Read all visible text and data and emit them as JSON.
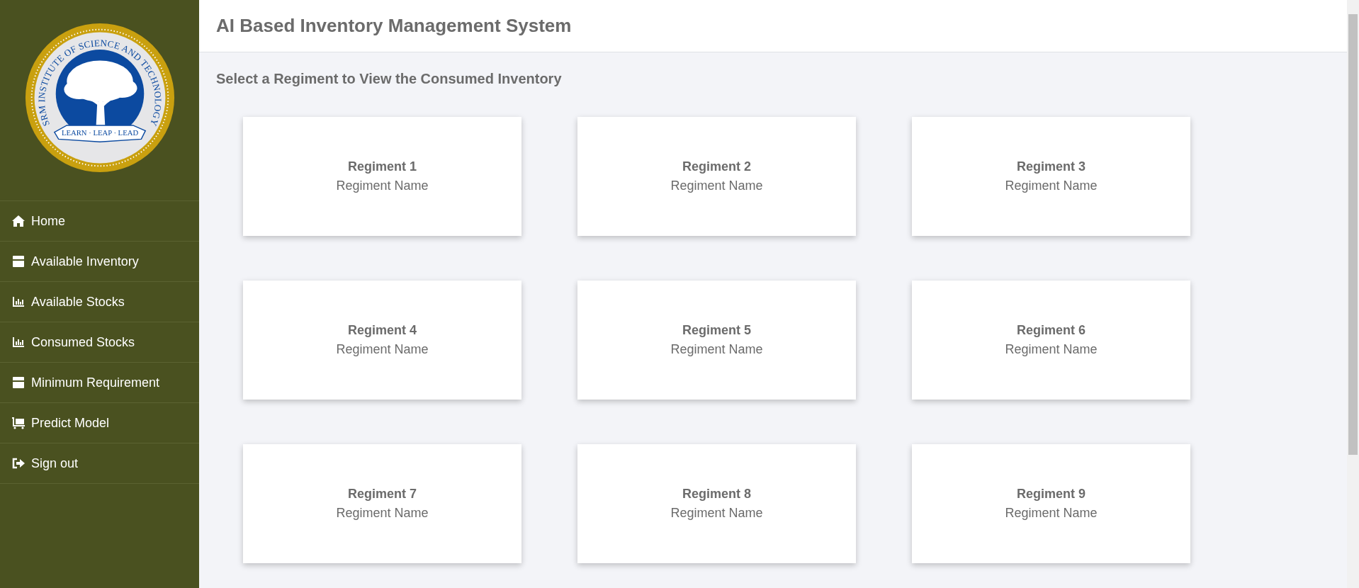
{
  "logo": {
    "ring_text": "SRM INSTITUTE OF SCIENCE AND TECHNOLOGY",
    "motto": "LEARN · LEAP · LEAD"
  },
  "sidebar": {
    "items": [
      {
        "label": "Home",
        "kind": "home"
      },
      {
        "label": "Available Inventory",
        "kind": "box"
      },
      {
        "label": "Available Stocks",
        "kind": "chart"
      },
      {
        "label": "Consumed Stocks",
        "kind": "chart"
      },
      {
        "label": "Minimum Requirement",
        "kind": "box"
      },
      {
        "label": "Predict Model",
        "kind": "cart"
      },
      {
        "label": "Sign out",
        "kind": "signout"
      }
    ]
  },
  "header": {
    "title": "AI Based Inventory Management System"
  },
  "subtitle": "Select a Regiment to View the Consumed Inventory",
  "regiments": [
    {
      "title": "Regiment 1",
      "name": "Regiment Name"
    },
    {
      "title": "Regiment 2",
      "name": "Regiment Name"
    },
    {
      "title": "Regiment 3",
      "name": "Regiment Name"
    },
    {
      "title": "Regiment 4",
      "name": "Regiment Name"
    },
    {
      "title": "Regiment 5",
      "name": "Regiment Name"
    },
    {
      "title": "Regiment 6",
      "name": "Regiment Name"
    },
    {
      "title": "Regiment 7",
      "name": "Regiment Name"
    },
    {
      "title": "Regiment 8",
      "name": "Regiment Name"
    },
    {
      "title": "Regiment 9",
      "name": "Regiment Name"
    }
  ]
}
